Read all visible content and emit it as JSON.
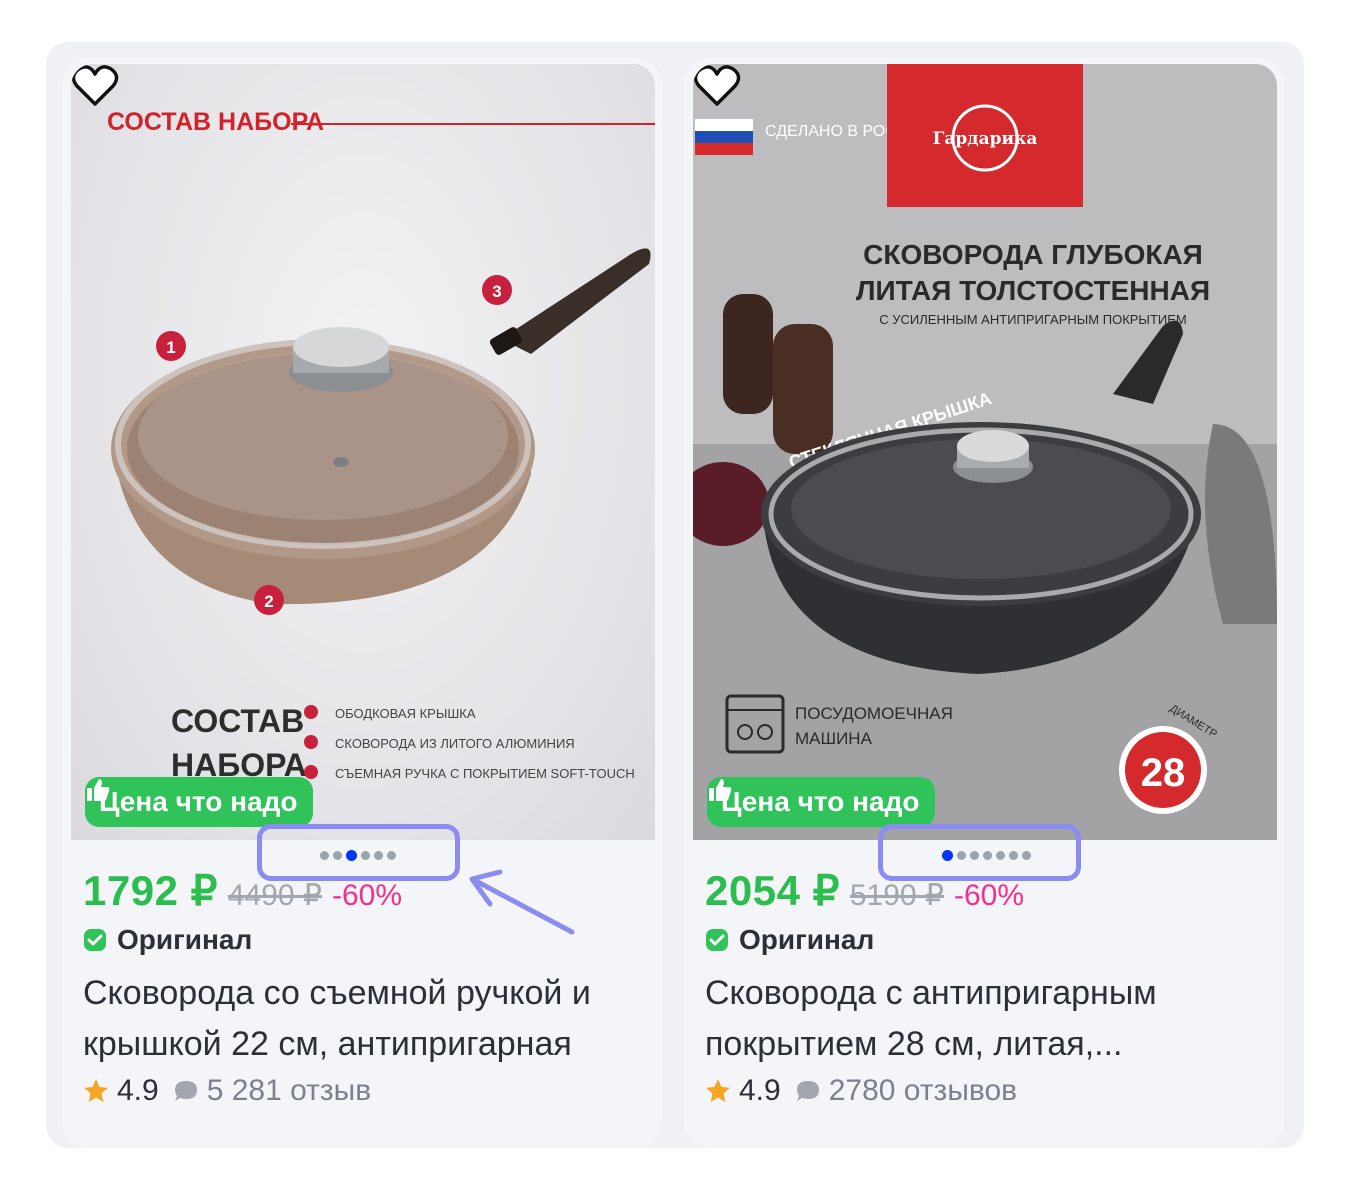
{
  "cards": [
    {
      "image_texts": {
        "header": "СОСТАВ НАБОРА",
        "callouts": [
          "1",
          "2",
          "3"
        ],
        "footer_title_1": "СОСТАВ",
        "footer_title_2": "НАБОРА",
        "list": [
          "ОБОДКОВАЯ КРЫШКА",
          "СКОВОРОДА ИЗ ЛИТОГО АЛЮМИНИЯ",
          "СЪЕМНАЯ РУЧКА С ПОКРЫТИЕМ SOFT-TOUCH"
        ]
      },
      "badge": "Цена что надо",
      "carousel": {
        "count": 6,
        "active": 2
      },
      "price": "1792 ₽",
      "old_price": "4490 ₽",
      "discount": "-60%",
      "original": "Оригинал",
      "title_line1": "Сковорода со съемной ручкой и",
      "title_line2": "крышкой 22 см, антипригарная",
      "rating": "4.9",
      "reviews": "5 281 отзыв"
    },
    {
      "image_texts": {
        "made": "СДЕЛАНО В РОССИИ",
        "brand": "Гардарика",
        "headline_1": "СКОВОРОДА ГЛУБОКАЯ",
        "headline_2": "ЛИТАЯ ТОЛСТОСТЕННАЯ",
        "subline": "С УСИЛЕННЫМ АНТИПРИГАРНЫМ ПОКРЫТИЕМ",
        "lid": "СТЕКЛЯННАЯ КРЫШКА",
        "dishwasher_1": "ПОСУДОМОЕЧНАЯ",
        "dishwasher_2": "МАШИНА",
        "diameter_label": "ДИАМЕТР",
        "diameter": "28"
      },
      "badge": "Цена что надо",
      "carousel": {
        "count": 7,
        "active": 0
      },
      "price": "2054 ₽",
      "old_price": "5190 ₽",
      "discount": "-60%",
      "original": "Оригинал",
      "title_line1": "Сковорода с антипригарным",
      "title_line2": "покрытием 28 см, литая,...",
      "rating": "4.9",
      "reviews": "2780 отзывов"
    }
  ],
  "colors": {
    "price_green": "#2bbd4d",
    "discount_pink": "#f3308d",
    "badge_green": "#2fc35a",
    "active_dot": "#0034ff",
    "highlight": "#8a8cf2"
  }
}
